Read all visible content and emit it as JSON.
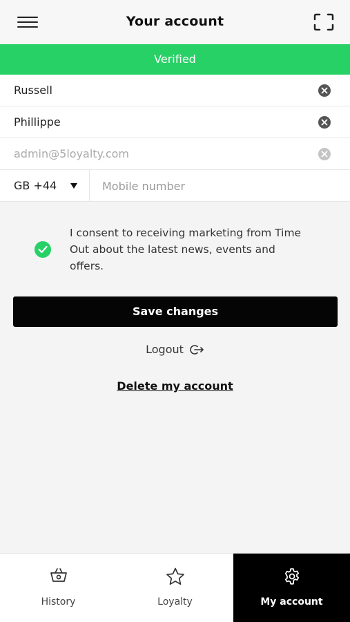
{
  "header": {
    "title": "Your account",
    "menu_icon": "hamburger-menu-icon",
    "scan_icon": "scan-frame-icon"
  },
  "status": {
    "label": "Verified",
    "color": "#27d166"
  },
  "form": {
    "first_name": "Russell",
    "last_name": "Phillippe",
    "email": "admin@5loyalty.com",
    "country_code": "GB +44",
    "mobile_placeholder": "Mobile number"
  },
  "consent": {
    "checked": true,
    "text": "I consent to receiving marketing from Time Out about the latest news, events and offers."
  },
  "actions": {
    "save_label": "Save changes",
    "logout_label": "Logout",
    "delete_label": "Delete my account"
  },
  "tabs": [
    {
      "label": "History",
      "icon": "basket-icon",
      "active": false
    },
    {
      "label": "Loyalty",
      "icon": "star-icon",
      "active": false
    },
    {
      "label": "My account",
      "icon": "gear-icon",
      "active": true
    }
  ]
}
